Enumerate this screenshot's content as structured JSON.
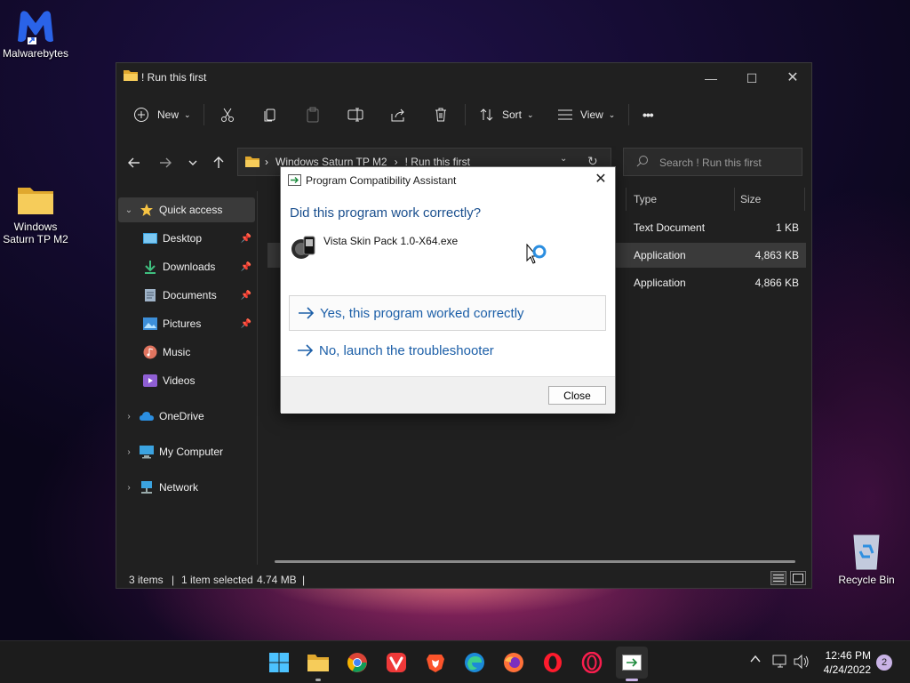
{
  "desktop": {
    "icons": [
      {
        "label": "Malwarebytes"
      },
      {
        "label": "Windows Saturn TP M2"
      },
      {
        "label": "Recycle Bin"
      }
    ]
  },
  "explorer": {
    "title": "! Run this first",
    "toolbar": {
      "new_label": "New",
      "sort_label": "Sort",
      "view_label": "View",
      "more_label": "•••"
    },
    "address": {
      "crumbs": [
        "Windows Saturn TP M2",
        "! Run this first"
      ]
    },
    "search": {
      "placeholder": "Search ! Run this first"
    },
    "nav": {
      "quick_access": "Quick access",
      "items": [
        {
          "label": "Desktop",
          "pinned": true
        },
        {
          "label": "Downloads",
          "pinned": true
        },
        {
          "label": "Documents",
          "pinned": true
        },
        {
          "label": "Pictures",
          "pinned": true
        },
        {
          "label": "Music",
          "pinned": false
        },
        {
          "label": "Videos",
          "pinned": false
        }
      ],
      "onedrive": "OneDrive",
      "my_computer": "My Computer",
      "network": "Network"
    },
    "columns": {
      "type": "Type",
      "size": "Size"
    },
    "rows": [
      {
        "type": "Text Document",
        "size": "1 KB",
        "selected": false
      },
      {
        "type": "Application",
        "size": "4,863 KB",
        "selected": true
      },
      {
        "type": "Application",
        "size": "4,866 KB",
        "selected": false
      }
    ],
    "status": {
      "items": "3 items",
      "selected": "1 item selected",
      "size": "4.74 MB"
    }
  },
  "dialog": {
    "title": "Program Compatibility Assistant",
    "question": "Did this program work correctly?",
    "program": "Vista Skin Pack 1.0-X64.exe",
    "option_yes": "Yes, this program worked correctly",
    "option_no": "No, launch the troubleshooter",
    "close_button": "Close"
  },
  "taskbar": {
    "apps": [
      "start",
      "file-explorer",
      "chrome",
      "vivaldi",
      "brave",
      "edge",
      "firefox",
      "opera",
      "opera-gx",
      "program-compatibility"
    ],
    "time": "12:46 PM",
    "date": "4/24/2022",
    "notification_count": "2"
  },
  "colors": {
    "accent": "#1c5fa8",
    "dialog_heading": "#1a4f8e",
    "folder": "#f2c14e"
  }
}
